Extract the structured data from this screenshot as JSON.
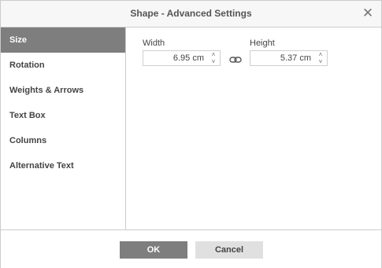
{
  "dialog": {
    "title": "Shape - Advanced Settings",
    "close_glyph": "✕"
  },
  "sidebar": {
    "items": [
      {
        "label": "Size",
        "active": true
      },
      {
        "label": "Rotation",
        "active": false
      },
      {
        "label": "Weights & Arrows",
        "active": false
      },
      {
        "label": "Text Box",
        "active": false
      },
      {
        "label": "Columns",
        "active": false
      },
      {
        "label": "Alternative Text",
        "active": false
      }
    ]
  },
  "size": {
    "width_label": "Width",
    "width_value": "6.95 cm",
    "height_label": "Height",
    "height_value": "5.37 cm",
    "spin_up_glyph": "˄",
    "spin_down_glyph": "˅",
    "constrain_icon": "link-icon"
  },
  "footer": {
    "ok_label": "OK",
    "cancel_label": "Cancel"
  },
  "colors": {
    "active_background": "#7e7e7e",
    "cancel_background": "#e0e0e0",
    "border": "#cbcbcb",
    "titlebar": "#f7f7f7"
  }
}
